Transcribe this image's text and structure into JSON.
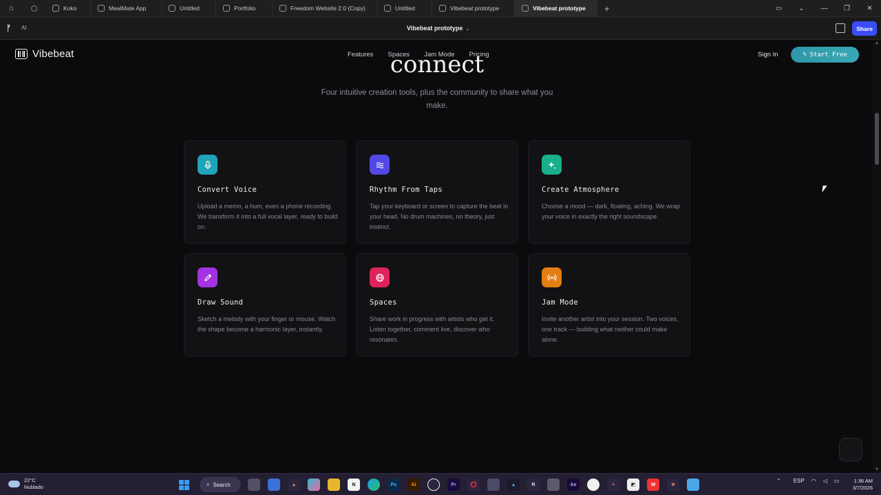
{
  "browser": {
    "tabs": [
      {
        "label": "Koko",
        "active": false
      },
      {
        "label": "MealMate App",
        "active": false
      },
      {
        "label": "Untitled",
        "active": false
      },
      {
        "label": "Portfolio",
        "active": false
      },
      {
        "label": "Freedom Website 2.0 (Copy)",
        "active": false
      },
      {
        "label": "Untitled",
        "active": false
      },
      {
        "label": "Vibebeat prototype",
        "active": false
      },
      {
        "label": "Vibebeat prototype",
        "active": true
      }
    ]
  },
  "toolbar": {
    "ai_label": "AI",
    "project_title": "Vibebeat prototype",
    "share_label": "Share"
  },
  "site": {
    "brand": "Vibebeat",
    "nav": [
      "Features",
      "Spaces",
      "Jam Mode",
      "Pricing"
    ],
    "sign_in": "Sign In",
    "cta": "Start Free",
    "heading_partial": "connect",
    "subtitle": "Four intuitive creation tools, plus the community to share what you make.",
    "cards": [
      {
        "title": "Convert Voice",
        "desc": "Upload a memo, a hum, even a phone recording. We transform it into a full vocal layer, ready to build on.",
        "icon": "microphone-icon",
        "color": "#1fa3b8"
      },
      {
        "title": "Rhythm From Taps",
        "desc": "Tap your keyboard or screen to capture the beat in your head. No drum machines, no theory, just instinct.",
        "icon": "waves-icon",
        "color": "#5148e6"
      },
      {
        "title": "Create Atmosphere",
        "desc": "Choose a mood — dark, floating, aching. We wrap your voice in exactly the right soundscape.",
        "icon": "sparkles-icon",
        "color": "#17b08a"
      },
      {
        "title": "Draw Sound",
        "desc": "Sketch a melody with your finger or mouse. Watch the shape become a harmonic layer, instantly.",
        "icon": "pencil-icon",
        "color": "#a333e0"
      },
      {
        "title": "Spaces",
        "desc": "Share work in progress with artists who get it. Listen together, comment live, discover who resonates.",
        "icon": "globe-icon",
        "color": "#e0235a"
      },
      {
        "title": "Jam Mode",
        "desc": "Invite another artist into your session. Two voices, one track — building what neither could make alone.",
        "icon": "broadcast-icon",
        "color": "#e57e12"
      }
    ]
  },
  "taskbar": {
    "temp": "22°C",
    "condition": "Nublado",
    "search": "Search",
    "lang": "ESP",
    "time": "1:36 AM",
    "date": "3/7/2026"
  }
}
